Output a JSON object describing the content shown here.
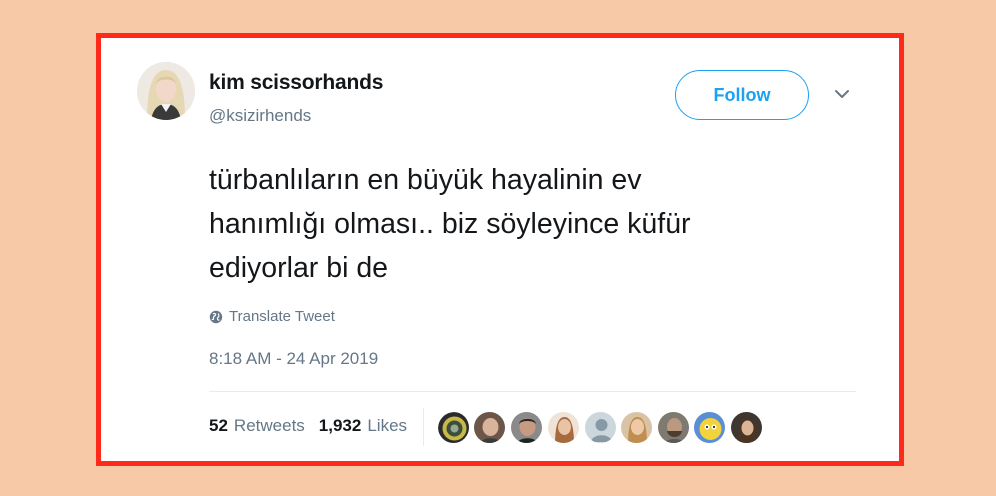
{
  "tweet": {
    "user": {
      "name": "kim scissorhands",
      "handle": "@ksizirhends"
    },
    "follow_label": "Follow",
    "text_lines": [
      "türbanlıların en büyük hayalinin ev",
      "hanımlığı olması.. biz söyleyince küfür",
      "ediyorlar bi de"
    ],
    "translate_label": "Translate Tweet",
    "timestamp": "8:18 AM - 24 Apr 2019",
    "stats": {
      "retweets_count": "52",
      "retweets_label": "Retweets",
      "likes_count": "1,932",
      "likes_label": "Likes"
    }
  },
  "colors": {
    "page_background": "#f8c9a6",
    "frame_border": "#ff2a1a",
    "twitter_blue": "#1da1f2",
    "secondary_text": "#657786",
    "primary_text": "#14171a"
  },
  "icons": {
    "chevron": "chevron-down-icon",
    "translate": "globe-icon"
  }
}
